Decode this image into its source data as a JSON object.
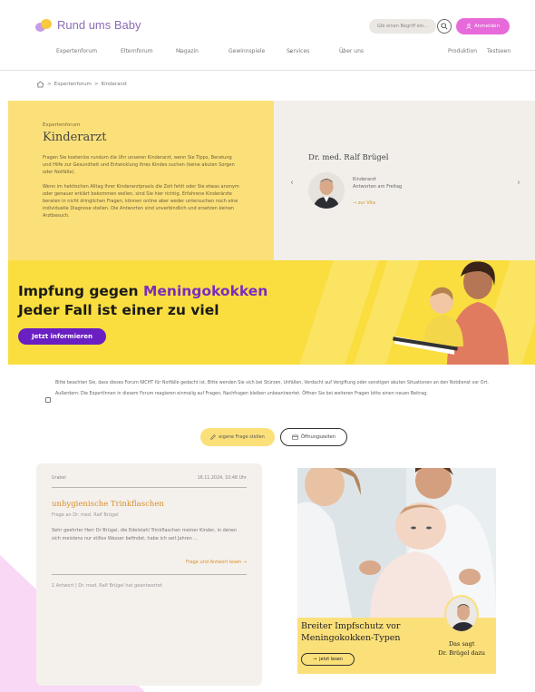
{
  "header": {
    "logo_text": "Rund ums Baby",
    "search_placeholder": "Gib einen Begriff ein...",
    "login_label": "Anmelden"
  },
  "nav": {
    "items": [
      "Expertenforum",
      "Elternforum",
      "Magazin",
      "Gewinnspiele",
      "Services",
      "Über uns"
    ],
    "right_items": [
      "Produktion",
      "Testseen"
    ]
  },
  "breadcrumb": {
    "items": [
      "Expertenforum",
      "Kinderarzt"
    ],
    "separator": ">"
  },
  "hero": {
    "eyebrow": "Expertenforum",
    "title": "Kinderarzt",
    "paragraph1": "Fragen Sie kostenlos rundum die Uhr unseren Kinderarzt, wenn Sie Tipps, Beratung und Hilfe zur Gesundheit und Entwicklung Ihres Kindes suchen (keine akuten Sorgen oder Notfälle).",
    "paragraph2": "Wenn im hektischen Alltag Ihrer Kinderarztpraxis die Zeit fehlt oder Sie etwas anonym oder genauer erklärt bekommen wollen, sind Sie hier richtig. Erfahrene Kinderärzte beraten in nicht dringlichen Fragen, können online aber weder untersuchen noch eine individuelle Diagnose stellen. Die Antworten sind unverbindlich und ersetzen keinen Arztbesuch.",
    "expert_name": "Dr. med. Ralf Brügel",
    "expert_role": "Kinderarzt",
    "expert_days": "Antworten am Freitag",
    "expert_link": "zur Vita",
    "prev_arrow": "‹",
    "next_arrow": "›"
  },
  "ad_banner": {
    "line1_a": "Impfung gegen ",
    "line1_b": "Meningokokken",
    "line2": "Jeder Fall ist einer zu viel",
    "cta": "Jetzt informieren",
    "colors": {
      "background": "#fadd3f",
      "accent": "#7b2dbd",
      "button": "#6a1fc2"
    }
  },
  "notice": {
    "text1": "Bitte beachten Sie, dass dieses Forum NICHT für Notfälle gedacht ist. Bitte wenden Sie sich bei Stürzen, Unfällen, Verdacht auf Vergiftung oder sonstigen akuten Situationen an den Notdienst vor Ort.",
    "text2": "Außerdem: Die ExpertInnen in diesem Forum reagieren einmalig auf Fragen, Nachfragen bleiben unbeantwortet. Öffnen Sie bei weiteren Fragen bitte einen neuen Beitrag."
  },
  "actions": {
    "ask_label": "eigene Frage stellen",
    "hours_label": "Öffnungszeiten"
  },
  "question": {
    "category": "Urabel",
    "date": "16.11.2024, 10:48 Uhr",
    "title": "unhygienische Trinkflaschen",
    "subtitle": "Frage an Dr. med. Ralf Brügel",
    "excerpt": "Sehr geehrter Herr Dr Brügel, die Edelstahl Trinkflaschen meiner Kinder, in denen sich meistens nur stilles Wasser befindet, habe ich seit Jahren ...",
    "more_label": "Frage und Antwort lesen",
    "footer": "1 Antwort | Dr. med. Ralf Brügel hat geantwortet"
  },
  "ad2": {
    "title_line1": "Breiter Impfschutz vor",
    "title_line2": "Meningokokken-Typen",
    "button": "jetzt lesen",
    "quote_line1": "Das sagt",
    "quote_line2": "Dr. Brügel dazu"
  }
}
